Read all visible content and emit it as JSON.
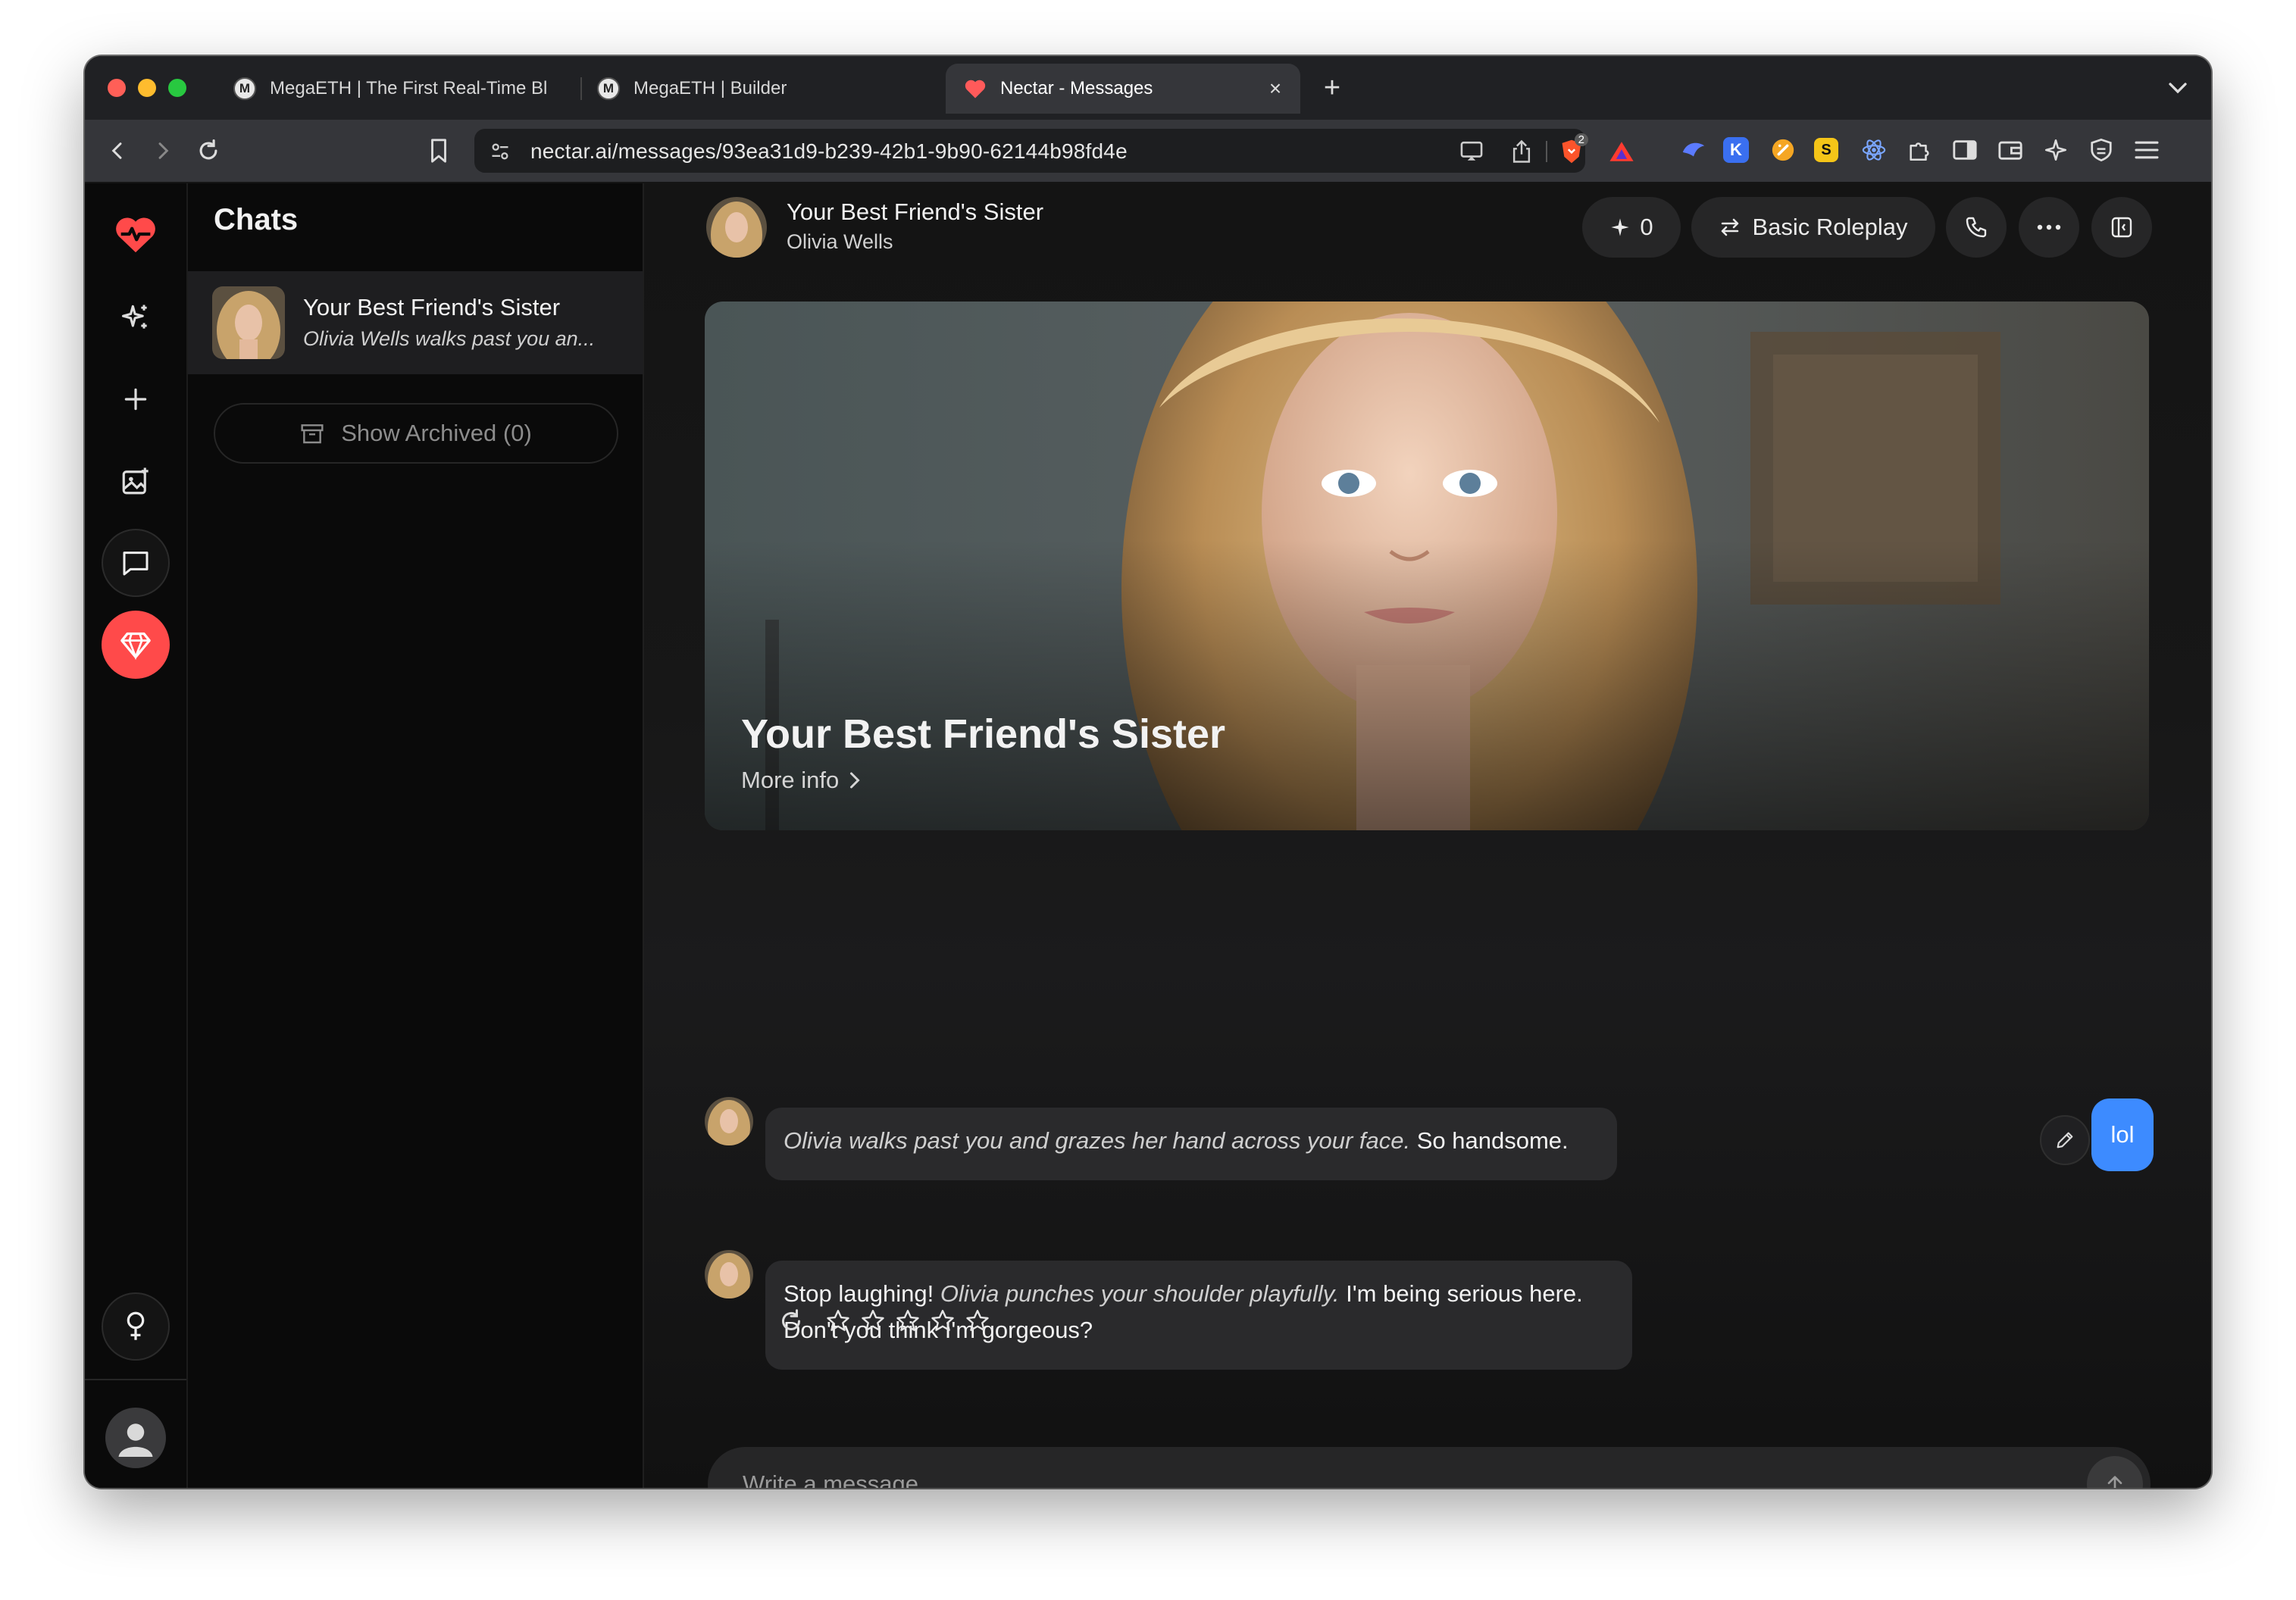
{
  "browser": {
    "tabs": [
      {
        "label": "MegaETH | The First Real-Time Bl",
        "favicon": "M"
      },
      {
        "label": "MegaETH | Builder",
        "favicon": "M"
      },
      {
        "label": "Nectar - Messages",
        "favicon": "heart",
        "active": true
      }
    ],
    "url": "nectar.ai/messages/93ea31d9-b239-42b1-9b90-62144b98fd4e",
    "brave_badge": "2",
    "traffic_colors": [
      "#ff5f57",
      "#febc2e",
      "#28c840"
    ]
  },
  "sidebar": {
    "title": "Chats",
    "chats": [
      {
        "title": "Your Best Friend's Sister",
        "preview": "Olivia Wells walks past you an..."
      }
    ],
    "archived_label": "Show Archived (0)"
  },
  "header": {
    "title": "Your Best Friend's Sister",
    "subtitle": "Olivia Wells",
    "sparkle_count": "0",
    "mode_label": "Basic Roleplay"
  },
  "hero": {
    "title": "Your Best Friend's Sister",
    "more_info": "More info"
  },
  "messages": [
    {
      "from": "bot",
      "action": "Olivia walks past you and grazes her hand across your face.",
      "text": " So handsome."
    },
    {
      "from": "user",
      "text": "lol"
    },
    {
      "from": "bot",
      "text_before": "Stop laughing! ",
      "action": "Olivia punches your shoulder playfully.",
      "text_after": " I'm being serious here. Don't you think I'm gorgeous?",
      "rating": 0,
      "rating_max": 5
    }
  ],
  "composer": {
    "placeholder": "Write a message"
  },
  "colors": {
    "brand": "#ff4a4a",
    "user_bubble": "#3d8bff",
    "bot_bubble": "#2a2a2c",
    "background": "#0c0c0e"
  }
}
